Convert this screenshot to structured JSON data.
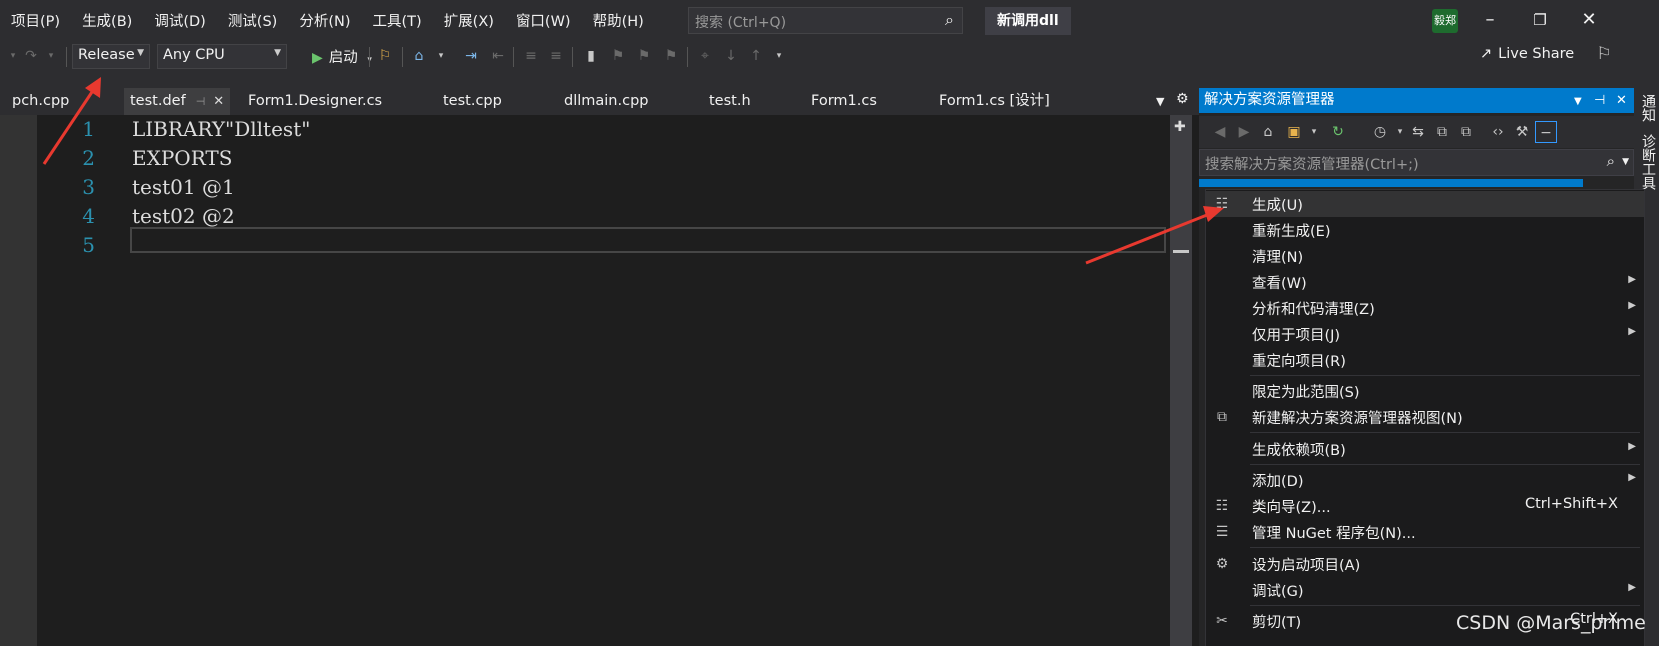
{
  "menubar": {
    "items": [
      "项目(P)",
      "生成(B)",
      "调试(D)",
      "测试(S)",
      "分析(N)",
      "工具(T)",
      "扩展(X)",
      "窗口(W)",
      "帮助(H)"
    ],
    "search_placeholder": "搜索 (Ctrl+Q)",
    "solution_name": "新调用dll",
    "user_initials": "毅郑"
  },
  "toolbar": {
    "configuration": "Release",
    "platform": "Any CPU",
    "start_label": "启动",
    "live_share": "Live Share"
  },
  "tabs": [
    {
      "label": "pch.cpp"
    },
    {
      "label": "test.def",
      "active": true
    },
    {
      "label": "Form1.Designer.cs"
    },
    {
      "label": "test.cpp"
    },
    {
      "label": "dllmain.cpp"
    },
    {
      "label": "test.h"
    },
    {
      "label": "Form1.cs"
    },
    {
      "label": "Form1.cs [设计]"
    }
  ],
  "editor": {
    "lines": [
      {
        "n": "1",
        "text": "LIBRARY\"Dlltest\""
      },
      {
        "n": "2",
        "text": "EXPORTS"
      },
      {
        "n": "3",
        "text": "test01 @1"
      },
      {
        "n": "4",
        "text": "test02 @2"
      },
      {
        "n": "5",
        "text": ""
      }
    ]
  },
  "solution_explorer": {
    "title": "解决方案资源管理器",
    "search_placeholder": "搜索解决方案资源管理器(Ctrl+;)"
  },
  "side_tabs": [
    "通知",
    "诊断工具"
  ],
  "context_menu": {
    "items": [
      {
        "label": "生成(U)",
        "icon": "build-icon"
      },
      {
        "label": "重新生成(E)"
      },
      {
        "label": "清理(N)"
      },
      {
        "label": "查看(W)",
        "submenu": true
      },
      {
        "label": "分析和代码清理(Z)",
        "submenu": true
      },
      {
        "label": "仅用于项目(J)",
        "submenu": true
      },
      {
        "label": "重定向项目(R)"
      },
      {
        "label": "限定为此范围(S)"
      },
      {
        "label": "新建解决方案资源管理器视图(N)",
        "icon": "new-view-icon"
      },
      {
        "label": "生成依赖项(B)",
        "submenu": true
      },
      {
        "label": "添加(D)",
        "submenu": true
      },
      {
        "label": "类向导(Z)...",
        "shortcut": "Ctrl+Shift+X",
        "icon": "class-wizard-icon"
      },
      {
        "label": "管理 NuGet 程序包(N)...",
        "icon": "nuget-icon"
      },
      {
        "label": "设为启动项目(A)",
        "icon": "gear-icon"
      },
      {
        "label": "调试(G)",
        "submenu": true
      },
      {
        "label": "剪切(T)",
        "shortcut": "Ctrl+X",
        "icon": "cut-icon"
      }
    ]
  },
  "watermark": "CSDN @Mars_prime",
  "colors": {
    "accent": "#007acc",
    "annotation": "#e8392f",
    "line_number": "#2b91af"
  }
}
